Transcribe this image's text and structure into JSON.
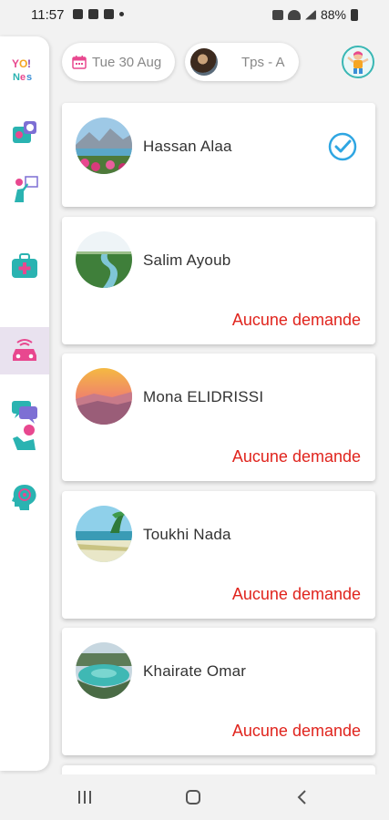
{
  "status_bar": {
    "time": "11:57",
    "battery": "88%"
  },
  "sidebar": {
    "items": [
      {
        "name": "home-logo",
        "icon": "logo-icon"
      },
      {
        "name": "photos",
        "icon": "photo-icon"
      },
      {
        "name": "activities",
        "icon": "teacher-board-icon"
      },
      {
        "name": "health",
        "icon": "first-aid-bag-icon"
      },
      {
        "name": "transport",
        "icon": "car-icon",
        "active": true
      },
      {
        "name": "messages",
        "icon": "chat-bubbles-icon"
      },
      {
        "name": "raise-hand",
        "icon": "raised-hand-icon"
      },
      {
        "name": "mind",
        "icon": "brain-head-icon"
      }
    ]
  },
  "header": {
    "date": "Tue 30 Aug",
    "class_label": "Tps - A"
  },
  "students": [
    {
      "name": "Hassan Alaa",
      "status": "",
      "checked": true
    },
    {
      "name": "Salim Ayoub",
      "status": "Aucune demande",
      "checked": false
    },
    {
      "name": "Mona ELIDRISSI",
      "status": "Aucune demande",
      "checked": false
    },
    {
      "name": "Toukhi Nada",
      "status": "Aucune demande",
      "checked": false
    },
    {
      "name": "Khairate Omar",
      "status": "Aucune demande",
      "checked": false
    }
  ],
  "colors": {
    "accent_teal": "#2ab3b1",
    "accent_pink": "#e8488f",
    "status_red": "#e0241d",
    "check_blue": "#2fa6e2"
  }
}
